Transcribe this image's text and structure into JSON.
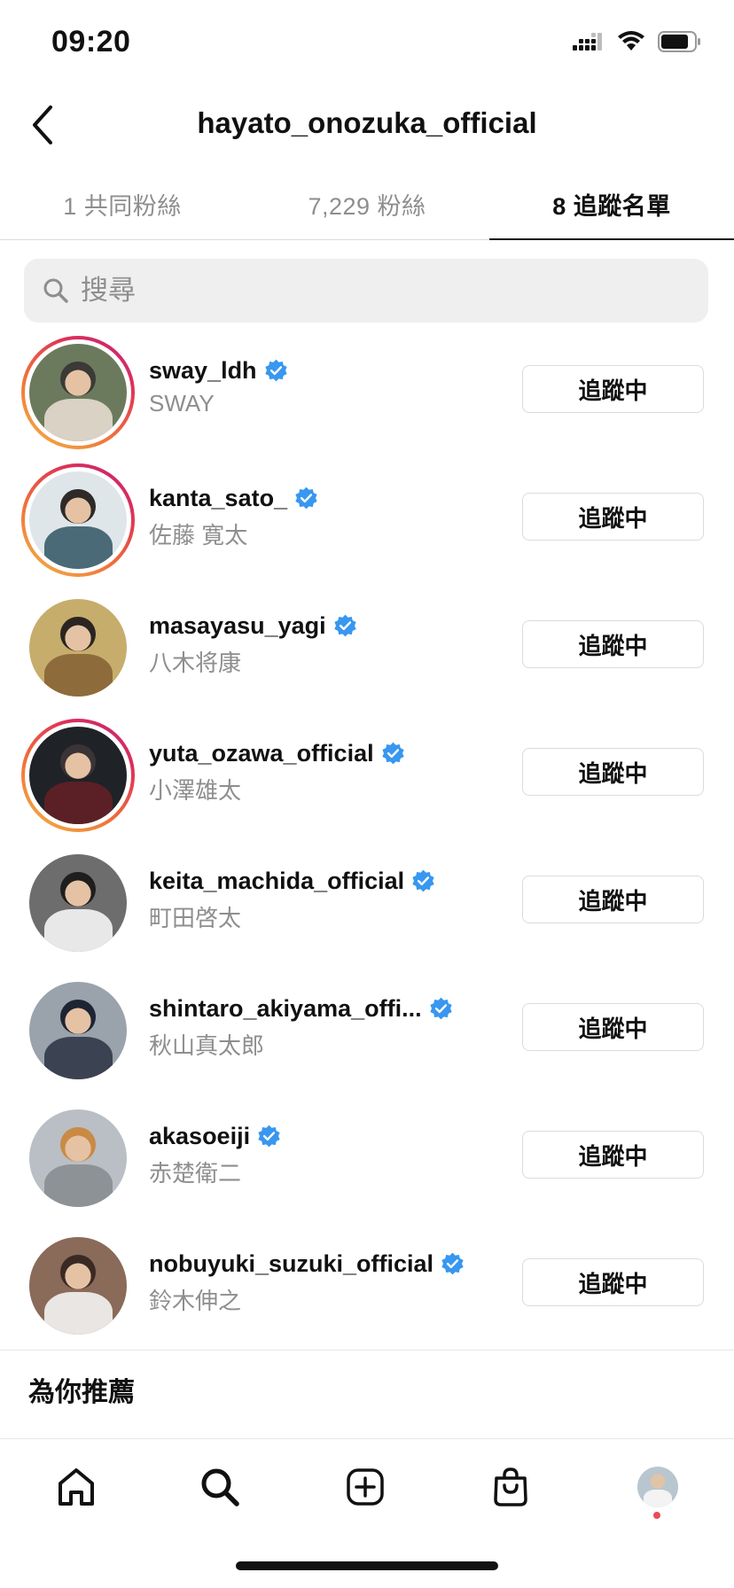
{
  "status_bar": {
    "time": "09:20"
  },
  "header": {
    "title": "hayato_onozuka_official",
    "back_icon": "chevron-left-icon"
  },
  "tabs": [
    {
      "label": "1 共同粉絲",
      "active": false
    },
    {
      "label": "7,229 粉絲",
      "active": false
    },
    {
      "label": "8 追蹤名單",
      "active": true
    }
  ],
  "search": {
    "placeholder": "搜尋",
    "value": ""
  },
  "users": [
    {
      "username": "sway_ldh",
      "full_name": "SWAY",
      "verified": true,
      "story_ring": true,
      "button": "追蹤中",
      "avatar_colors": [
        "#6b7a5c",
        "#3b3a36",
        "#d9d2c5"
      ]
    },
    {
      "username": "kanta_sato_",
      "full_name": "佐藤 寛太",
      "verified": true,
      "story_ring": true,
      "button": "追蹤中",
      "avatar_colors": [
        "#dfe6ea",
        "#2d2a28",
        "#4a6a78"
      ]
    },
    {
      "username": "masayasu_yagi",
      "full_name": "八木将康",
      "verified": true,
      "story_ring": false,
      "button": "追蹤中",
      "avatar_colors": [
        "#c7ad6c",
        "#2a2520",
        "#8d6b3a"
      ]
    },
    {
      "username": "yuta_ozawa_official",
      "full_name": "小澤雄太",
      "verified": true,
      "story_ring": true,
      "button": "追蹤中",
      "avatar_colors": [
        "#1f2226",
        "#3a3436",
        "#5a2025"
      ]
    },
    {
      "username": "keita_machida_official",
      "full_name": "町田啓太",
      "verified": true,
      "story_ring": false,
      "button": "追蹤中",
      "avatar_colors": [
        "#6d6d6d",
        "#1e1e1e",
        "#e8e8e8"
      ]
    },
    {
      "username": "shintaro_akiyama_offi...",
      "full_name": "秋山真太郎",
      "verified": true,
      "story_ring": false,
      "button": "追蹤中",
      "avatar_colors": [
        "#9aa3ab",
        "#1d2433",
        "#3b4252"
      ]
    },
    {
      "username": "akasoeiji",
      "full_name": "赤楚衛二",
      "verified": true,
      "story_ring": false,
      "button": "追蹤中",
      "avatar_colors": [
        "#b9bfc4",
        "#c98a44",
        "#8d9296"
      ]
    },
    {
      "username": "nobuyuki_suzuki_official",
      "full_name": "鈴木伸之",
      "verified": true,
      "story_ring": false,
      "button": "追蹤中",
      "avatar_colors": [
        "#8a6a58",
        "#3a2a24",
        "#e9e6e3"
      ]
    }
  ],
  "suggested": {
    "title": "為你推薦"
  },
  "bottom_nav": {
    "items": [
      "home-icon",
      "search-icon",
      "new-post-icon",
      "shop-icon",
      "profile-avatar"
    ],
    "notification_dot_color": "#ed4956"
  },
  "colors": {
    "verified": "#3897f0",
    "secondary_text": "#8e8e8e",
    "border": "#dbdbdb"
  }
}
